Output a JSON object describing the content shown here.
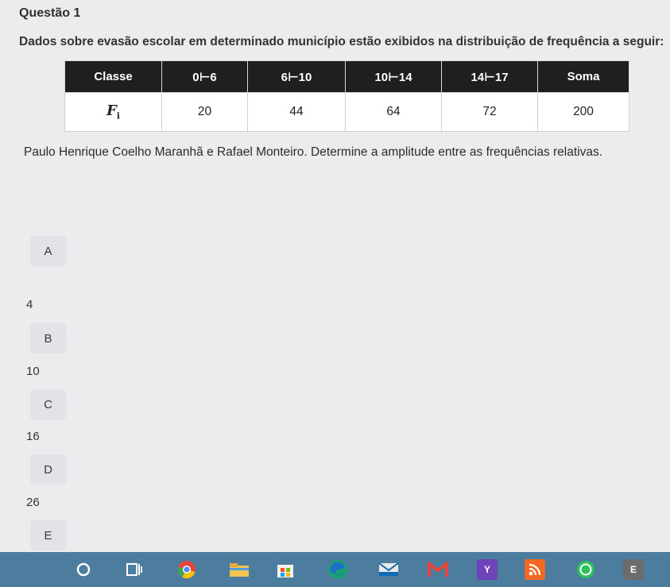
{
  "question": {
    "title": "Questão 1",
    "intro": "Dados sobre evasão escolar em determinado município estão exibidos na distribuição de frequência a seguir:",
    "text": "Paulo Henrique Coelho Maranhã e Rafael Monteiro. Determine a amplitude entre as frequências relativas."
  },
  "table": {
    "headers": [
      "Classe",
      "0⊢6",
      "6⊢10",
      "10⊢14",
      "14⊢17",
      "Soma"
    ],
    "row_label": "F",
    "row_label_sub": "i",
    "values": [
      "20",
      "44",
      "64",
      "72",
      "200"
    ]
  },
  "options": [
    {
      "letter": "A",
      "value": "4"
    },
    {
      "letter": "B",
      "value": "10"
    },
    {
      "letter": "C",
      "value": "16"
    },
    {
      "letter": "D",
      "value": "26"
    },
    {
      "letter": "E",
      "value": ""
    }
  ],
  "taskbar": {
    "icons": [
      "cortana-icon",
      "task-view-icon",
      "chrome-icon",
      "file-explorer-icon",
      "store-icon",
      "edge-icon",
      "mail-icon",
      "gmail-icon",
      "yahoo-icon",
      "rss-icon",
      "whatsapp-icon",
      "e-app-icon"
    ],
    "y_label": "Y",
    "e_label": "E",
    "bar_color": "#4c7d9f"
  }
}
